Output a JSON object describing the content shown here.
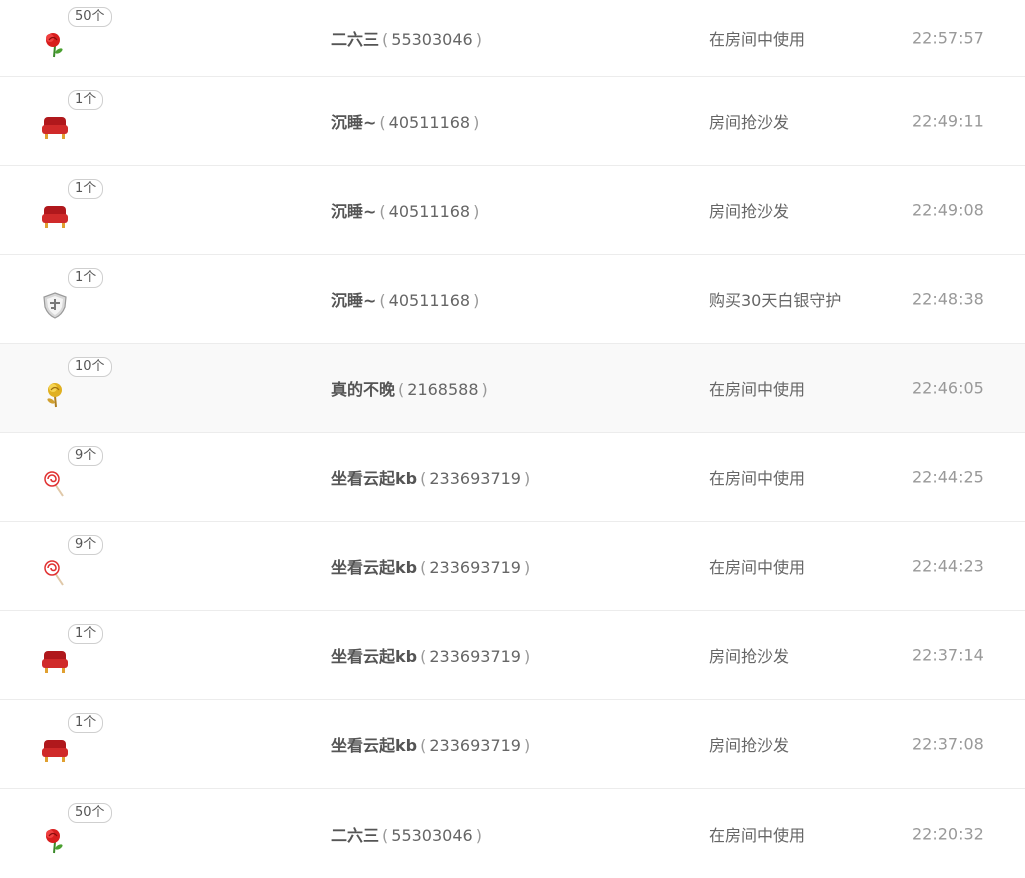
{
  "records": [
    {
      "icon": "rose-icon",
      "count": "50个",
      "user": "二六三",
      "uid": "55303046",
      "action": "在房间中使用",
      "time": "22:57:57"
    },
    {
      "icon": "sofa-icon",
      "count": "1个",
      "user": "沉睡~",
      "uid": "40511168",
      "action": "房间抢沙发",
      "time": "22:49:11"
    },
    {
      "icon": "sofa-icon",
      "count": "1个",
      "user": "沉睡~",
      "uid": "40511168",
      "action": "房间抢沙发",
      "time": "22:49:08"
    },
    {
      "icon": "guard-shield-icon",
      "count": "1个",
      "user": "沉睡~",
      "uid": "40511168",
      "action": "购买30天白银守护",
      "time": "22:48:38"
    },
    {
      "icon": "golden-rose-icon",
      "count": "10个",
      "user": "真的不晚",
      "uid": "2168588",
      "action": "在房间中使用",
      "time": "22:46:05"
    },
    {
      "icon": "lollipop-icon",
      "count": "9个",
      "user": "坐看云起kb",
      "uid": "233693719",
      "action": "在房间中使用",
      "time": "22:44:25"
    },
    {
      "icon": "lollipop-icon",
      "count": "9个",
      "user": "坐看云起kb",
      "uid": "233693719",
      "action": "在房间中使用",
      "time": "22:44:23"
    },
    {
      "icon": "sofa-icon",
      "count": "1个",
      "user": "坐看云起kb",
      "uid": "233693719",
      "action": "房间抢沙发",
      "time": "22:37:14"
    },
    {
      "icon": "sofa-icon",
      "count": "1个",
      "user": "坐看云起kb",
      "uid": "233693719",
      "action": "房间抢沙发",
      "time": "22:37:08"
    },
    {
      "icon": "rose-icon",
      "count": "50个",
      "user": "二六三",
      "uid": "55303046",
      "action": "在房间中使用",
      "time": "22:20:32"
    }
  ],
  "punct": {
    "open": "(",
    "close": ")"
  },
  "colors": {
    "rose": "#d81e1e",
    "sofa": "#b0181c",
    "gold": "#e0b020",
    "shield": "#b8b8b8"
  }
}
